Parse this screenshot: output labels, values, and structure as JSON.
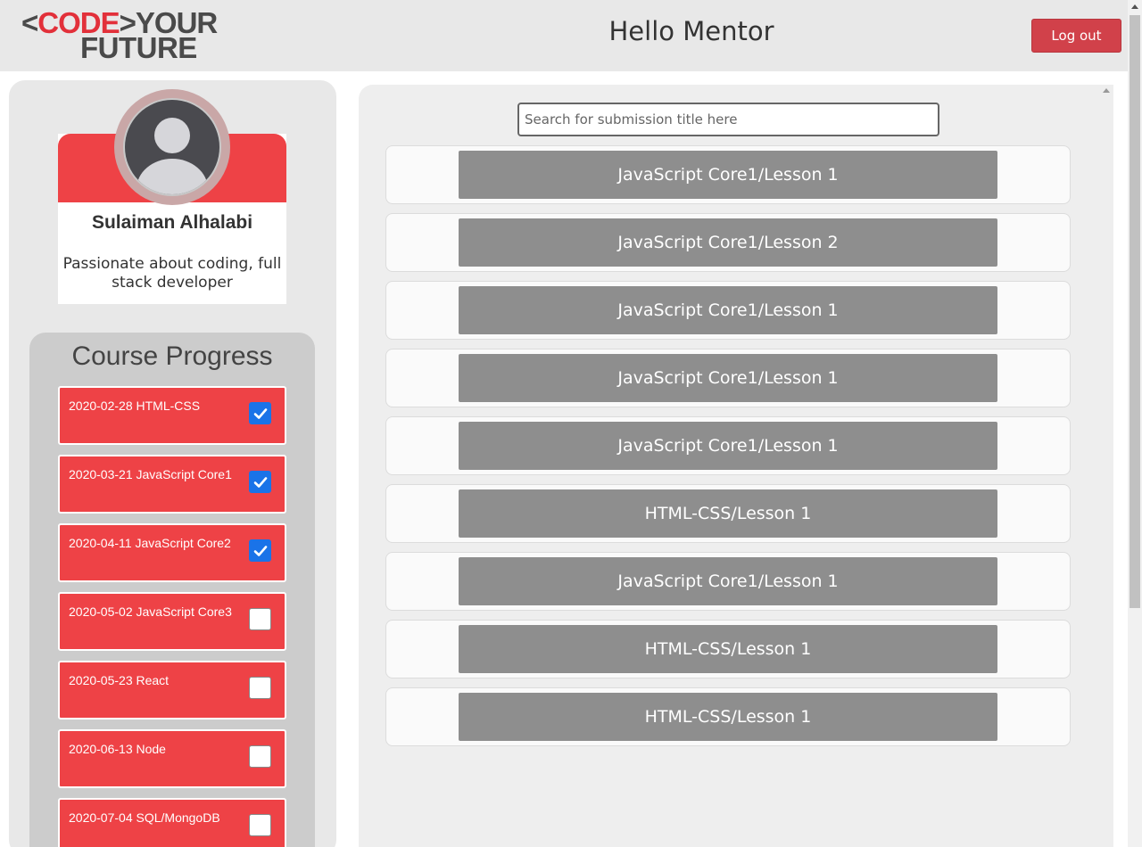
{
  "header": {
    "logo_part1_left": "<",
    "logo_part1_red": "CODE",
    "logo_part1_right": ">YOUR",
    "logo_part2": "FUTURE",
    "title": "Hello Mentor",
    "logout_label": "Log out"
  },
  "profile": {
    "name": "Sulaiman Alhalabi",
    "bio": "Passionate about coding, full stack developer",
    "avatar_icon": "user-silhouette-icon"
  },
  "progress": {
    "title": "Course Progress",
    "items": [
      {
        "label": "2020-02-28 HTML-CSS",
        "checked": true
      },
      {
        "label": "2020-03-21 JavaScript Core1",
        "checked": true
      },
      {
        "label": "2020-04-11 JavaScript Core2",
        "checked": true
      },
      {
        "label": "2020-05-02 JavaScript Core3",
        "checked": false
      },
      {
        "label": "2020-05-23 React",
        "checked": false
      },
      {
        "label": "2020-06-13 Node",
        "checked": false
      },
      {
        "label": "2020-07-04 SQL/MongoDB",
        "checked": false
      }
    ]
  },
  "search": {
    "placeholder": "Search for submission title here",
    "value": ""
  },
  "submissions": [
    {
      "title": "JavaScript Core1/Lesson 1"
    },
    {
      "title": "JavaScript Core1/Lesson 2"
    },
    {
      "title": "JavaScript Core1/Lesson 1"
    },
    {
      "title": "JavaScript Core1/Lesson 1"
    },
    {
      "title": "JavaScript Core1/Lesson 1"
    },
    {
      "title": "HTML-CSS/Lesson 1"
    },
    {
      "title": "JavaScript Core1/Lesson 1"
    },
    {
      "title": "HTML-CSS/Lesson 1"
    },
    {
      "title": "HTML-CSS/Lesson 1"
    }
  ],
  "colors": {
    "brand_red": "#ee4246",
    "logout_red": "#d1414a",
    "submission_gray": "#8e8e8e",
    "checkbox_blue": "#1a73e8"
  }
}
